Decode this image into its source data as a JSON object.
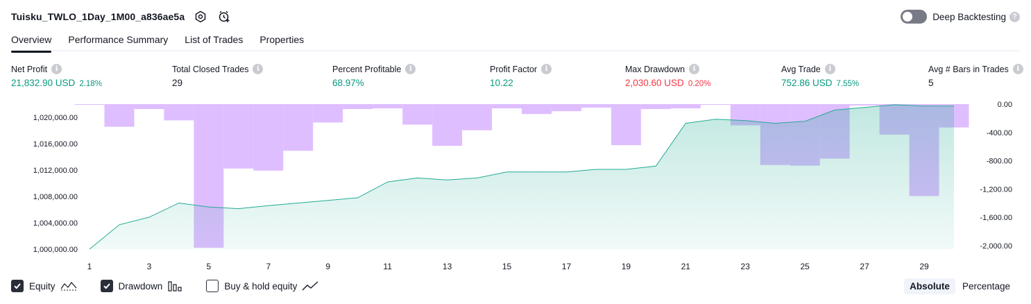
{
  "header": {
    "strategy_title": "Tuisku_TWLO_1Day_1M00_a836ae5a",
    "deep_backtesting_label": "Deep Backtesting"
  },
  "tabs": [
    {
      "label": "Overview",
      "active": true
    },
    {
      "label": "Performance Summary",
      "active": false
    },
    {
      "label": "List of Trades",
      "active": false
    },
    {
      "label": "Properties",
      "active": false
    }
  ],
  "stats": {
    "net_profit": {
      "label": "Net Profit",
      "value": "21,832.90 USD",
      "pct": "2.18%"
    },
    "total_closed_trades": {
      "label": "Total Closed Trades",
      "value": "29"
    },
    "percent_profitable": {
      "label": "Percent Profitable",
      "value": "68.97%"
    },
    "profit_factor": {
      "label": "Profit Factor",
      "value": "10.22"
    },
    "max_drawdown": {
      "label": "Max Drawdown",
      "value": "2,030.60 USD",
      "pct": "0.20%"
    },
    "avg_trade": {
      "label": "Avg Trade",
      "value": "752.86 USD",
      "pct": "7.55%"
    },
    "avg_bars": {
      "label": "Avg # Bars in Trades",
      "value": "5"
    }
  },
  "chart_data": {
    "type": "area",
    "x_ticks": [
      "1",
      "3",
      "5",
      "7",
      "9",
      "11",
      "13",
      "15",
      "17",
      "19",
      "21",
      "23",
      "25",
      "27",
      "29"
    ],
    "y_left_ticks": [
      "1,000,000.00",
      "1,004,000.00",
      "1,008,000.00",
      "1,012,000.00",
      "1,016,000.00",
      "1,020,000.00"
    ],
    "y_right_ticks": [
      "-2,000.00",
      "-1,600.00",
      "-1,200.00",
      "-800.00",
      "-400.00",
      "0.00"
    ],
    "y_left_range": [
      1000000,
      1022000
    ],
    "y_right_range": [
      -2050,
      0
    ],
    "x_range": [
      1,
      30
    ],
    "equity": {
      "x": [
        1,
        2,
        3,
        4,
        5,
        6,
        7,
        8,
        9,
        10,
        11,
        12,
        13,
        14,
        15,
        16,
        17,
        18,
        19,
        20,
        21,
        22,
        23,
        24,
        25,
        26,
        27,
        28,
        29,
        30
      ],
      "values": [
        1000000,
        1003700,
        1004850,
        1007000,
        1006400,
        1006150,
        1006600,
        1007000,
        1007400,
        1007800,
        1010200,
        1010800,
        1010500,
        1010800,
        1011700,
        1011700,
        1011700,
        1012100,
        1012100,
        1012600,
        1019100,
        1019700,
        1019500,
        1019100,
        1019400,
        1021100,
        1021500,
        1021900,
        1021700,
        1021700
      ]
    },
    "drawdown": {
      "x": [
        1,
        2,
        3,
        4,
        5,
        6,
        7,
        8,
        9,
        10,
        11,
        12,
        13,
        14,
        15,
        16,
        17,
        18,
        19,
        20,
        21,
        22,
        23,
        24,
        25,
        26,
        27,
        28,
        29,
        30
      ],
      "values": [
        -10,
        -320,
        -70,
        -230,
        -2030,
        -910,
        -940,
        -660,
        -260,
        -70,
        -60,
        -290,
        -590,
        -370,
        -60,
        -140,
        -100,
        -50,
        -580,
        -70,
        -60,
        -10,
        -300,
        -860,
        -870,
        -770,
        -20,
        -430,
        -1300,
        -330
      ]
    },
    "colors": {
      "equity_line": "#22ab94",
      "equity_fill": "#22ab94",
      "drawdown_bar": "#d9b3ff",
      "overlap_bar": "#b2b5e2"
    }
  },
  "legend": [
    {
      "label": "Equity",
      "checked": true,
      "icon": "equity-line-icon"
    },
    {
      "label": "Drawdown",
      "checked": true,
      "icon": "drawdown-bars-icon"
    },
    {
      "label": "Buy & hold equity",
      "checked": false,
      "icon": "buy-hold-line-icon"
    }
  ],
  "mode": {
    "absolute_label": "Absolute",
    "percentage_label": "Percentage",
    "selected": "Absolute"
  }
}
